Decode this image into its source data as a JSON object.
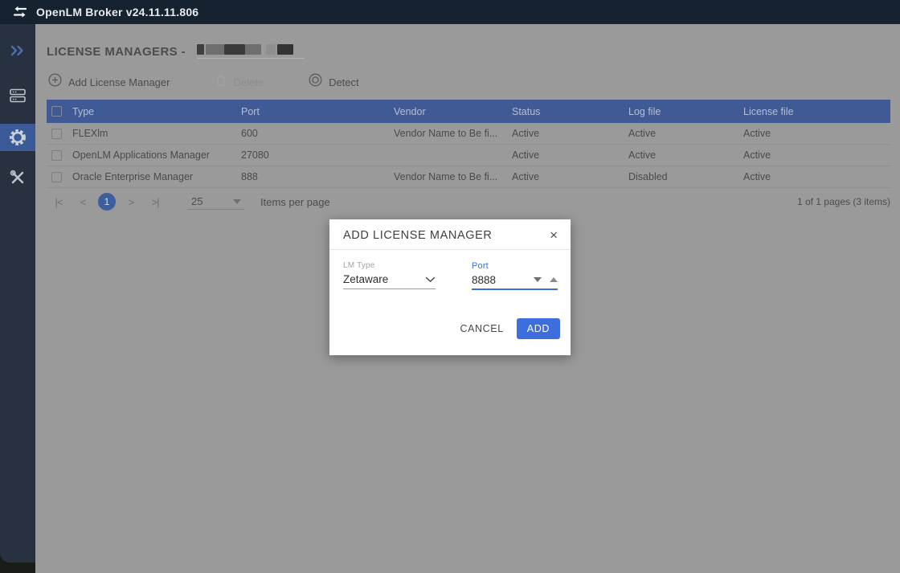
{
  "app": {
    "title": "OpenLM Broker v24.11.11.806"
  },
  "sidebar": {
    "icons": [
      "double-chevron-expand",
      "servers",
      "settings-gear",
      "tools"
    ]
  },
  "page": {
    "heading": "LICENSE MANAGERS -",
    "heading_hostname_redacted": true,
    "toolbar": {
      "add_label": "Add License Manager",
      "delete_label": "Delete",
      "detect_label": "Detect",
      "icons": [
        "circle-plus",
        "trash",
        "target-circles"
      ]
    },
    "table": {
      "columns": [
        "Type",
        "Port",
        "Vendor",
        "Status",
        "Log file",
        "License file"
      ],
      "rows": [
        {
          "type": "FLEXlm",
          "port": "600",
          "vendor": "Vendor Name to Be fi...",
          "status": "Active",
          "log_file": "Active",
          "license_file": "Active"
        },
        {
          "type": "OpenLM Applications Manager",
          "port": "27080",
          "vendor": "",
          "status": "Active",
          "log_file": "Active",
          "license_file": "Active"
        },
        {
          "type": "Oracle Enterprise Manager",
          "port": "888",
          "vendor": "Vendor Name to Be fi...",
          "status": "Active",
          "log_file": "Disabled",
          "license_file": "Active"
        }
      ]
    },
    "pagination": {
      "first": "|<",
      "prev": "<",
      "current_page": "1",
      "next": ">",
      "last": ">|",
      "page_size": "25",
      "items_per_page_label": "Items per page",
      "summary": "1 of 1 pages (3 items)"
    }
  },
  "modal": {
    "title": "ADD LICENSE MANAGER",
    "close_label": "×",
    "lm_type": {
      "label": "LM Type",
      "value": "Zetaware"
    },
    "port": {
      "label": "Port",
      "value": "8888"
    },
    "cancel_label": "CANCEL",
    "add_label": "ADD"
  },
  "colors": {
    "topbar": "#16222f",
    "sidebar": "#273140",
    "sidebar_active": "#3a5a99",
    "table_header": "#3f5a95",
    "accent_blue": "#3d6edd",
    "dim_overlay_gray": "#9a9a9a"
  }
}
